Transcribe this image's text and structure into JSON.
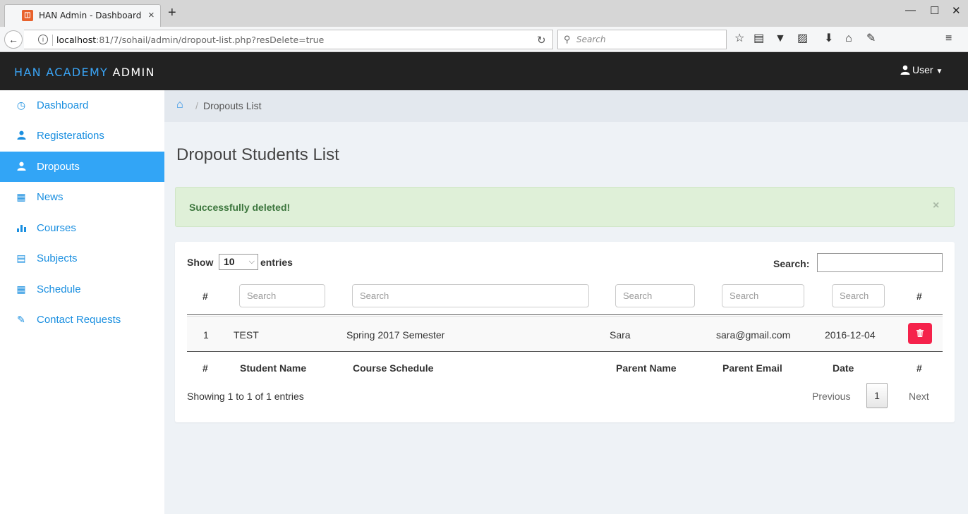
{
  "browser": {
    "tab_title": "HAN Admin - Dashboard",
    "tab_close": "×",
    "new_tab": "+",
    "url_host": "localhost",
    "url_rest": ":81/7/sohail/admin/dropout-list.php?resDelete=true",
    "search_placeholder": "Search",
    "window_controls": [
      "—",
      "☐",
      "✕"
    ]
  },
  "header": {
    "brand_part1": "HAN ACADEMY",
    "brand_part2": "ADMIN",
    "user_label": "User"
  },
  "sidebar": {
    "items": [
      {
        "label": "Dashboard",
        "icon": "dashboard-icon"
      },
      {
        "label": "Registerations",
        "icon": "user-icon"
      },
      {
        "label": "Dropouts",
        "icon": "user-icon",
        "active": true
      },
      {
        "label": "News",
        "icon": "grid-icon"
      },
      {
        "label": "Courses",
        "icon": "bar-chart-icon"
      },
      {
        "label": "Subjects",
        "icon": "calculator-icon"
      },
      {
        "label": "Schedule",
        "icon": "grid-icon"
      },
      {
        "label": "Contact Requests",
        "icon": "pencil-icon"
      }
    ]
  },
  "breadcrumb": {
    "separator": "/",
    "current": "Dropouts List"
  },
  "page": {
    "title": "Dropout Students List"
  },
  "alert": {
    "message": "Successfully deleted!",
    "close": "×"
  },
  "table": {
    "show_label": "Show",
    "length_value": "10",
    "entries_label": "entries",
    "search_label": "Search:",
    "filter_placeholder": "Search",
    "hash": "#",
    "columns": [
      "#",
      "Student Name",
      "Course Schedule",
      "Parent Name",
      "Parent Email",
      "Date",
      "#"
    ],
    "rows": [
      {
        "num": "1",
        "student": "TEST",
        "course": "Spring 2017 Semester",
        "parent": "Sara",
        "email": "sara@gmail.com",
        "date": "2016-12-04"
      }
    ],
    "info": "Showing 1 to 1 of 1 entries",
    "pagination": {
      "previous": "Previous",
      "current": "1",
      "next": "Next"
    }
  },
  "colors": {
    "accent": "#32a5f6",
    "header_bg": "#222222",
    "alert_bg": "#dff0d8",
    "danger": "#f5224b"
  }
}
